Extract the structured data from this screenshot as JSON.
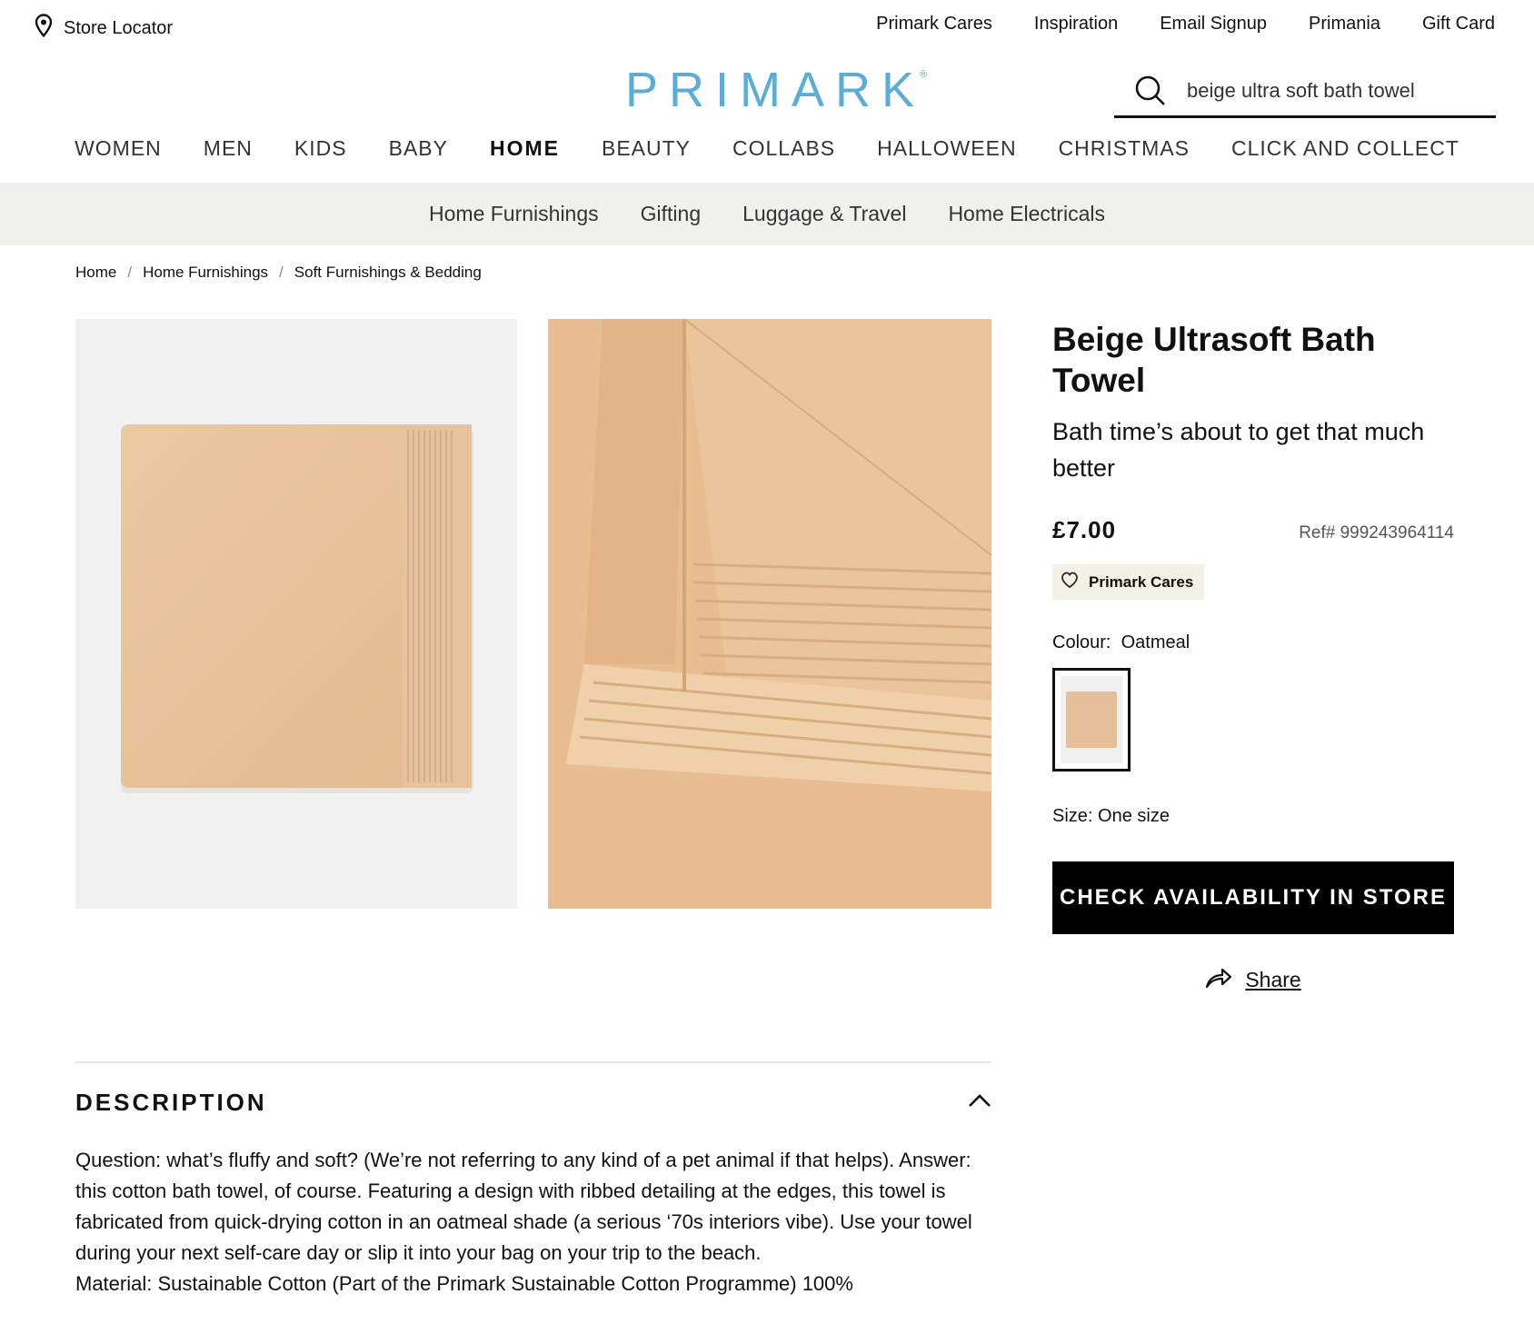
{
  "utility": {
    "store_locator": "Store Locator",
    "links": [
      "Primark Cares",
      "Inspiration",
      "Email Signup",
      "Primania",
      "Gift Card"
    ]
  },
  "logo": {
    "text": "PRIMARK",
    "mark": "®"
  },
  "search": {
    "value": "beige ultra soft bath towel",
    "icon": "search-icon"
  },
  "main_nav": [
    "WOMEN",
    "MEN",
    "KIDS",
    "BABY",
    "HOME",
    "BEAUTY",
    "COLLABS",
    "HALLOWEEN",
    "CHRISTMAS",
    "CLICK AND COLLECT"
  ],
  "active_nav": "HOME",
  "sub_nav": [
    "Home Furnishings",
    "Gifting",
    "Luggage & Travel",
    "Home Electricals"
  ],
  "breadcrumb": [
    "Home",
    "Home Furnishings",
    "Soft Furnishings & Bedding"
  ],
  "breadcrumb_sep": "/",
  "product": {
    "title": "Beige Ultrasoft Bath Towel",
    "subtitle": "Bath time’s about to get that much better",
    "price": "£7.00",
    "ref": "Ref# 999243964114",
    "badge": "Primark Cares",
    "colour_label": "Colour:",
    "colour_value": "Oatmeal",
    "size_label": "Size:",
    "size_value": "One size",
    "cta": "CHECK AVAILABILITY IN STORE",
    "share": "Share"
  },
  "description": {
    "heading": "DESCRIPTION",
    "body": "Question: what’s fluffy and soft? (We’re not referring to any kind of a pet animal if that helps). Answer: this cotton bath towel, of course. Featuring a design with ribbed detailing at the edges, this towel is fabricated from quick-drying cotton in an oatmeal shade (a serious ‘70s interiors vibe). Use your towel during your next self-care day or slip it into your bag on your trip to the beach.",
    "material": "Material: Sustainable Cotton (Part of the Primark Sustainable Cotton Programme) 100%"
  },
  "colors": {
    "brand": "#5aaed6",
    "towel": "#e5bf98",
    "cta_bg": "#000000"
  }
}
